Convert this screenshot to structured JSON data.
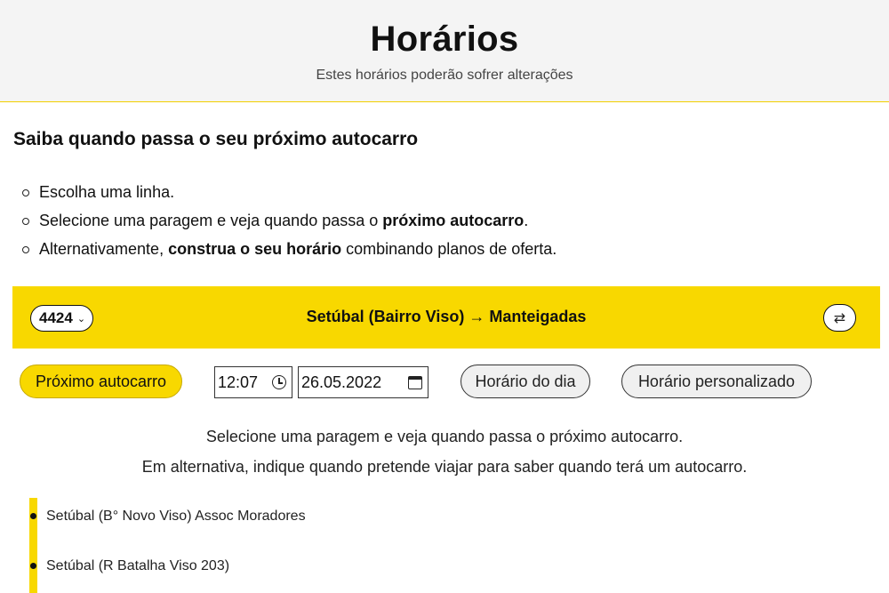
{
  "header": {
    "title": "Horários",
    "subtitle": "Estes horários poderão sofrer alterações"
  },
  "section": {
    "title": "Saiba quando passa o seu próximo autocarro"
  },
  "instructions": [
    {
      "text": "Escolha uma linha."
    },
    {
      "pre": "Selecione uma paragem e veja quando passa o ",
      "bold": "próximo autocarro",
      "post": "."
    },
    {
      "pre": "Alternativamente, ",
      "bold": "construa o seu horário",
      "post": " combinando planos de oferta."
    }
  ],
  "line_bar": {
    "line_number": "4424",
    "route": "Setúbal (Bairro Viso) → Manteigadas",
    "swap_icon": "⇄"
  },
  "controls": {
    "next_bus_label": "Próximo autocarro",
    "time_value": "12:07",
    "date_value": "26.05.2022",
    "day_schedule_label": "Horário do dia",
    "custom_schedule_label": "Horário personalizado"
  },
  "hints": {
    "line1": "Selecione uma paragem e veja quando passa o próximo autocarro.",
    "line2": "Em alternativa, indique quando pretende viajar para saber quando terá um autocarro."
  },
  "stops": [
    "Setúbal (B° Novo Viso) Assoc Moradores",
    "Setúbal (R Batalha Viso 203)"
  ],
  "colors": {
    "accent": "#f8d800",
    "header_bg": "#f4f4f4"
  }
}
